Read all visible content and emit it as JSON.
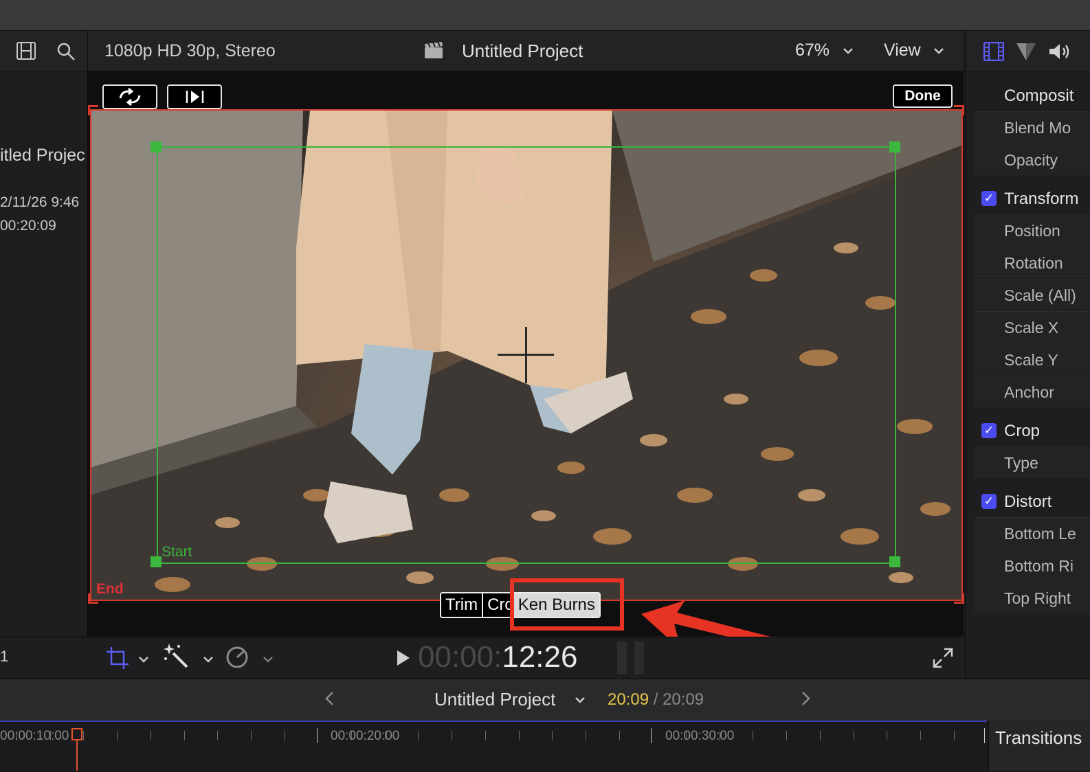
{
  "viewer_header": {
    "format": "1080p HD 30p, Stereo",
    "project_title": "Untitled Project",
    "zoom": "67%",
    "view_label": "View"
  },
  "left_pane": {
    "project_name": "itled Projec",
    "date": "2/11/26 9:46",
    "duration": "00:20:09",
    "bottom_number": "1"
  },
  "viewer": {
    "done_label": "Done",
    "start_label": "Start",
    "end_label": "End",
    "mode_tabs": [
      "Trim",
      "Cro",
      "Ken Burns"
    ],
    "selected_tab": "Ken Burns"
  },
  "playback": {
    "timecode_dim": "00:00:",
    "timecode_bright": "12:26"
  },
  "timeline_header": {
    "project_title": "Untitled Project",
    "current": "20:09",
    "separator": " / ",
    "total": "20:09"
  },
  "ruler": {
    "labels": [
      "00:00:10:00",
      "00:00:20:00",
      "00:00:30:00"
    ]
  },
  "transitions_label": "Transitions",
  "inspector": {
    "rows": [
      {
        "type": "section",
        "label": "Composit",
        "checked": false
      },
      {
        "type": "row",
        "label": "Blend Mo"
      },
      {
        "type": "row",
        "label": "Opacity"
      },
      {
        "type": "section",
        "label": "Transform",
        "checked": true
      },
      {
        "type": "row",
        "label": "Position"
      },
      {
        "type": "row",
        "label": "Rotation"
      },
      {
        "type": "row",
        "label": "Scale (All)"
      },
      {
        "type": "row",
        "label": "Scale X"
      },
      {
        "type": "row",
        "label": "Scale Y"
      },
      {
        "type": "row",
        "label": "Anchor"
      },
      {
        "type": "section",
        "label": "Crop",
        "checked": true
      },
      {
        "type": "row",
        "label": "Type"
      },
      {
        "type": "section",
        "label": "Distort",
        "checked": true
      },
      {
        "type": "row",
        "label": "Bottom Le"
      },
      {
        "type": "row",
        "label": "Bottom Ri"
      },
      {
        "type": "row",
        "label": "Top Right"
      }
    ]
  },
  "colors": {
    "accent": "#4a4cf0",
    "playhead": "#e8532c",
    "annotation_red": "#e63323",
    "start_green": "#38b53a",
    "end_red": "#d63a2c",
    "timecode_yellow": "#e6c84a"
  }
}
